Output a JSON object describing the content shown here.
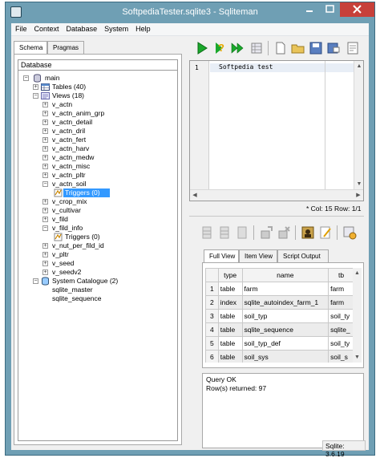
{
  "window": {
    "title": "SoftpediaTester.sqlite3 - Sqliteman"
  },
  "menu": [
    "File",
    "Context",
    "Database",
    "System",
    "Help"
  ],
  "left_tabs": [
    "Schema",
    "Pragmas"
  ],
  "tree": {
    "header": "Database",
    "root": "main",
    "tables": "Tables (40)",
    "views": "Views (18)",
    "view_items": [
      "v_actn",
      "v_actn_anim_grp",
      "v_actn_detail",
      "v_actn_dril",
      "v_actn_fert",
      "v_actn_harv",
      "v_actn_medw",
      "v_actn_misc",
      "v_actn_pltr",
      "v_actn_soil"
    ],
    "triggers_selected": "Triggers (0)",
    "view_items2": [
      "v_crop_mix",
      "v_cultivar",
      "v_fild",
      "v_fild_info"
    ],
    "triggers2": "Triggers (0)",
    "view_items3": [
      "v_nut_per_fild_id",
      "v_pltr",
      "v_seed",
      "v_seedv2"
    ],
    "system": "System Catalogue (2)",
    "system_items": [
      "sqlite_master",
      "sqlite_sequence"
    ]
  },
  "editor": {
    "line_number": "1",
    "code": "Softpedia test"
  },
  "status": {
    "cursor": "* Col: 15 Row: 1/1"
  },
  "result_tabs": [
    "Full View",
    "Item View",
    "Script Output"
  ],
  "grid": {
    "columns": [
      "type",
      "name",
      "tb"
    ],
    "rows": [
      {
        "n": "1",
        "type": "table",
        "name": "farm",
        "tb": "farm"
      },
      {
        "n": "2",
        "type": "index",
        "name": "sqlite_autoindex_farm_1",
        "tb": "farm"
      },
      {
        "n": "3",
        "type": "table",
        "name": "soil_typ",
        "tb": "soil_ty"
      },
      {
        "n": "4",
        "type": "table",
        "name": "sqlite_sequence",
        "tb": "sqlite_"
      },
      {
        "n": "5",
        "type": "table",
        "name": "soil_typ_def",
        "tb": "soil_ty"
      },
      {
        "n": "6",
        "type": "table",
        "name": "soil_sys",
        "tb": "soil_s"
      }
    ]
  },
  "output": {
    "line1": "Query OK",
    "line2": "Row(s) returned: 97"
  },
  "footer": {
    "version": "Sqlite: 3.6.19"
  },
  "colors": {
    "title_bar": "#6f9fb4",
    "close_button": "#c7403a",
    "selection": "#3399ff",
    "run_green": "#1aa82c"
  }
}
